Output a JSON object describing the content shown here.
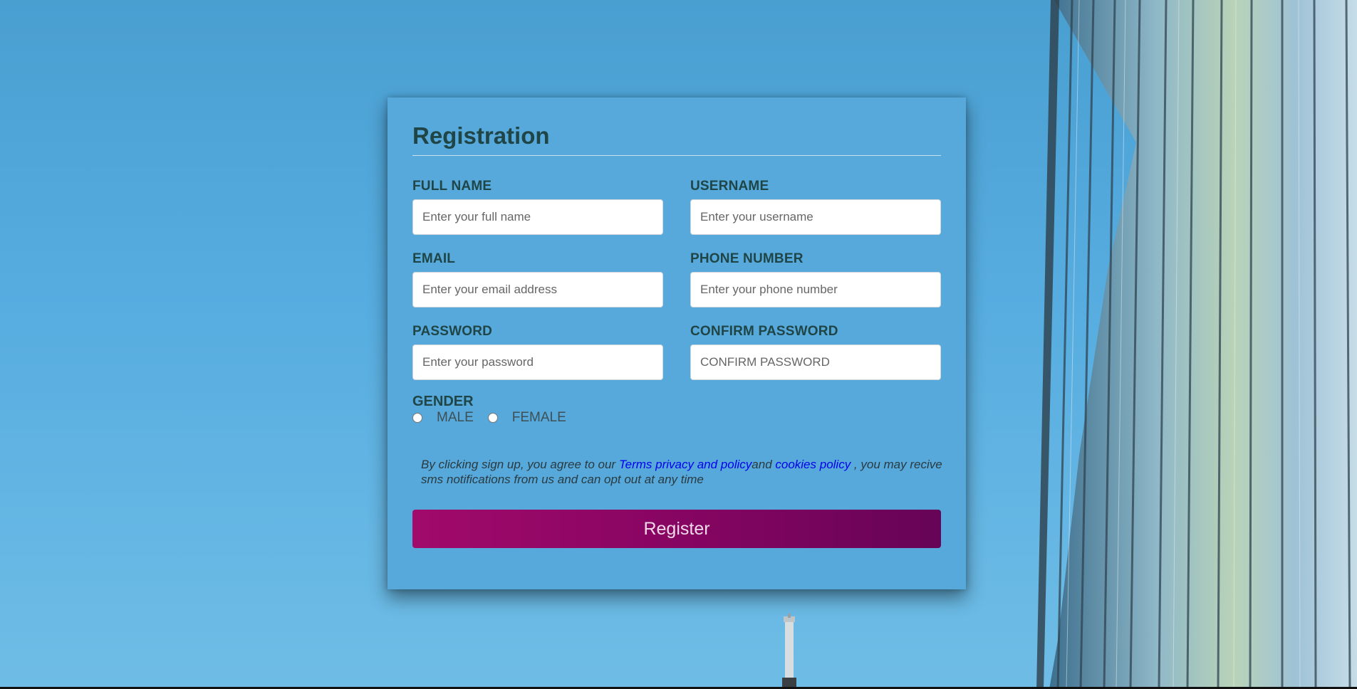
{
  "form": {
    "title": "Registration",
    "fields": {
      "full_name": {
        "label": "FULL NAME",
        "placeholder": "Enter your full name",
        "value": ""
      },
      "username": {
        "label": "USERNAME",
        "placeholder": "Enter your username",
        "value": ""
      },
      "email": {
        "label": "EMAIL",
        "placeholder": "Enter your email address",
        "value": ""
      },
      "phone": {
        "label": "PHONE NUMBER",
        "placeholder": "Enter your phone number",
        "value": ""
      },
      "password": {
        "label": "PASSWORD",
        "placeholder": "Enter your password",
        "value": ""
      },
      "confirm_password": {
        "label": "CONFIRM PASSWORD",
        "placeholder": "CONFIRM PASSWORD",
        "value": ""
      }
    },
    "gender": {
      "label": "GENDER",
      "options": [
        "MALE",
        "FEMALE"
      ]
    },
    "terms": {
      "prefix": "By clicking sign up, you agree to our ",
      "link1": "Terms privacy and policy",
      "middle": "and ",
      "link2": "cookies policy",
      "suffix": " , you may recive sms notifications from us and can opt out at any time"
    },
    "submit_label": "Register"
  },
  "colors": {
    "sky": "#56a9da",
    "heading": "#1f4547",
    "button_start": "#a10a6a",
    "button_end": "#660457",
    "link": "#0000ee"
  }
}
